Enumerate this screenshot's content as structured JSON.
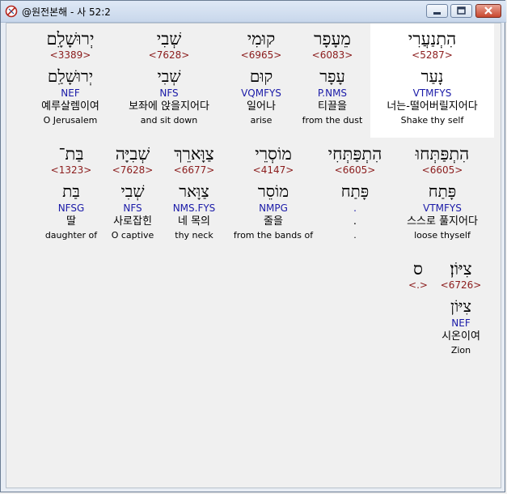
{
  "window": {
    "title": "@원전본해 - 사 52:2",
    "icon": "app-logo-icon",
    "buttons": [
      "minimize-icon",
      "maximize-icon",
      "close-icon"
    ],
    "colors": {
      "hebrew": "#000000",
      "strong_number": "#8b1c1c",
      "morphology": "#1a1aa8",
      "highlight_background": "#ffffff"
    }
  },
  "words": [
    {
      "hebrew": "הִתְנַעֲרִי",
      "strong": "<5287>",
      "lemma": "נָעַר",
      "morph": "VTMFYS",
      "korean": "너는-떨어버릴지어다",
      "english": "Shake thy self",
      "highlighted": true
    },
    {
      "hebrew": "מֵעָפָר",
      "strong": "<6083>",
      "lemma": "עָפָר",
      "morph": "P.NMS",
      "korean": "티끌을",
      "english": "from the dust",
      "highlighted": false
    },
    {
      "hebrew": "קוּמִי",
      "strong": "<6965>",
      "lemma": "קוּם",
      "morph": "VQMFYS",
      "korean": "일어나",
      "english": "arise",
      "highlighted": false
    },
    {
      "hebrew": "שְׁבִי",
      "strong": "<7628>",
      "lemma": "שְׁבִי",
      "morph": "NFS",
      "korean": "보좌에 앉을지어다",
      "english": "and sit down",
      "highlighted": false
    },
    {
      "hebrew": "יְרוּשָׁלִָם",
      "strong": "<3389>",
      "lemma": "יְרוּשָׁלִַם",
      "morph": "NEF",
      "korean": "예루살렘이여",
      "english": "O Jerusalem",
      "highlighted": false
    },
    {
      "hebrew": "הִתְפַּתְּחוּ",
      "strong": "<6605>",
      "lemma": "פָּתַח",
      "morph": "VTMFYS",
      "korean": "스스로 풀지어다",
      "english": "loose thyself",
      "highlighted": false
    },
    {
      "hebrew": "הִתְפַּתְּחִי",
      "strong": "<6605>",
      "lemma": "פָּתַח",
      "morph": ".",
      "korean": ".",
      "english": ".",
      "highlighted": false
    },
    {
      "hebrew": "מוֹסְרֵי",
      "strong": "<4147>",
      "lemma": "מוֹסֵר",
      "morph": "NMPG",
      "korean": "줄을",
      "english": "from the bands of",
      "highlighted": false
    },
    {
      "hebrew": "צַוָּארֵךְ",
      "strong": "<6677>",
      "lemma": "צַוָּאר",
      "morph": "NMS.FYS",
      "korean": "네 목의",
      "english": "thy neck",
      "highlighted": false
    },
    {
      "hebrew": "שְׁבִיָּה",
      "strong": "<7628>",
      "lemma": "שְׁבִי",
      "morph": "NFS",
      "korean": "사로잡힌",
      "english": "O captive",
      "highlighted": false
    },
    {
      "hebrew": "בַּת־",
      "strong": "<1323>",
      "lemma": "בַּת",
      "morph": "NFSG",
      "korean": "딸",
      "english": "daughter of",
      "highlighted": false
    },
    {
      "hebrew": "צִיּוֹן׃",
      "strong": "<6726>",
      "lemma": "צִיּוֹן",
      "morph": "NEF",
      "korean": "시온이여",
      "english": "Zion",
      "highlighted": false
    },
    {
      "hebrew": "ס",
      "strong": "<.>",
      "lemma": "",
      "morph": "",
      "korean": "",
      "english": "",
      "highlighted": false
    }
  ]
}
